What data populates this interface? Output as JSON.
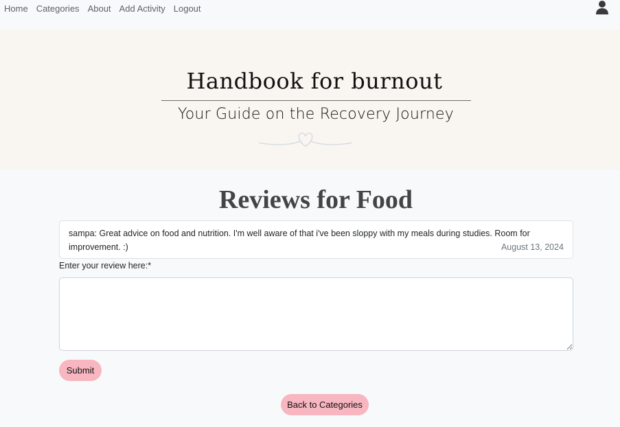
{
  "nav": {
    "items": [
      {
        "label": "Home"
      },
      {
        "label": "Categories"
      },
      {
        "label": "About"
      },
      {
        "label": "Add Activity"
      },
      {
        "label": "Logout"
      }
    ],
    "user_icon": "user-icon"
  },
  "hero": {
    "title": "Handbook for burnout",
    "subtitle": "Your Guide on the Recovery Journey",
    "ornament": "heart-swirl-icon"
  },
  "page": {
    "title": "Reviews for Food"
  },
  "reviews": [
    {
      "user": "sampa",
      "text": ": Great advice on food and nutrition. I'm well aware of that i've been sloppy with my meals during studies. Room for improvement. :)",
      "date": "August 13, 2024"
    }
  ],
  "form": {
    "label": "Enter your review here:*",
    "value": "",
    "submit_label": "Submit"
  },
  "back_label": "Back to Categories",
  "colors": {
    "button_pink": "#f7b6c0",
    "hero_bg": "#f9f6f1",
    "page_bg": "#f8f9fa",
    "title_gray": "#444444"
  }
}
